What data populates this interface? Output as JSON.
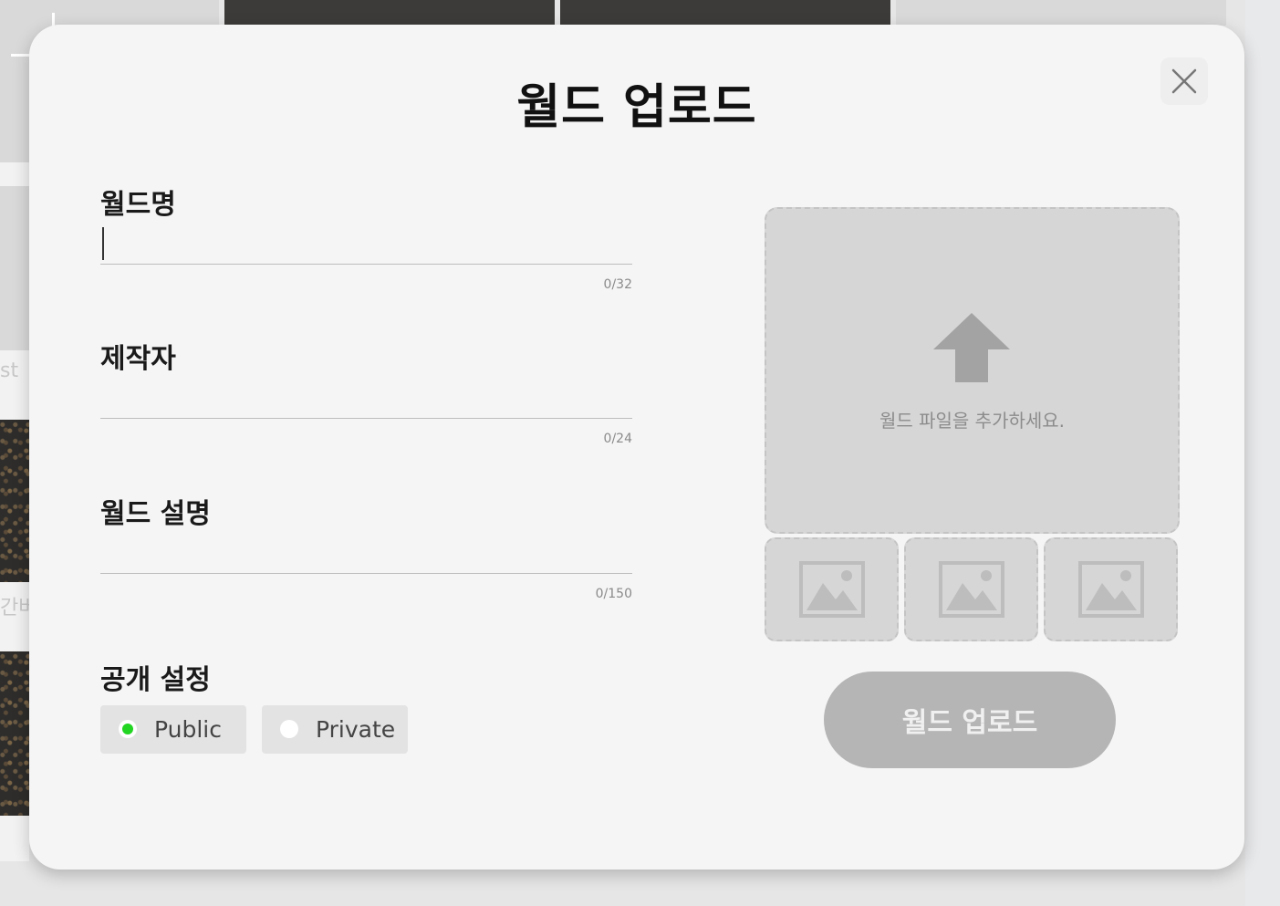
{
  "background": {
    "partial_texts": [
      "st",
      "간버"
    ]
  },
  "modal": {
    "title": "월드 업로드",
    "close_label": "close",
    "fields": {
      "world_name": {
        "label": "월드명",
        "value": "",
        "counter": "0/32"
      },
      "creator": {
        "label": "제작자",
        "value": "",
        "counter": "0/24"
      },
      "description": {
        "label": "월드 설명",
        "value": "",
        "counter": "0/150"
      }
    },
    "visibility": {
      "label": "공개 설정",
      "options": [
        {
          "label": "Public",
          "selected": true
        },
        {
          "label": "Private",
          "selected": false
        }
      ],
      "selected_color": "#22d522"
    },
    "upload": {
      "hint": "월드 파일을 추가하세요.",
      "thumbnail_count": 3
    },
    "submit_label": "월드 업로드"
  },
  "icons": {
    "close": "close-icon",
    "upload": "upload-arrow-icon",
    "thumbnail": "image-placeholder-icon"
  }
}
